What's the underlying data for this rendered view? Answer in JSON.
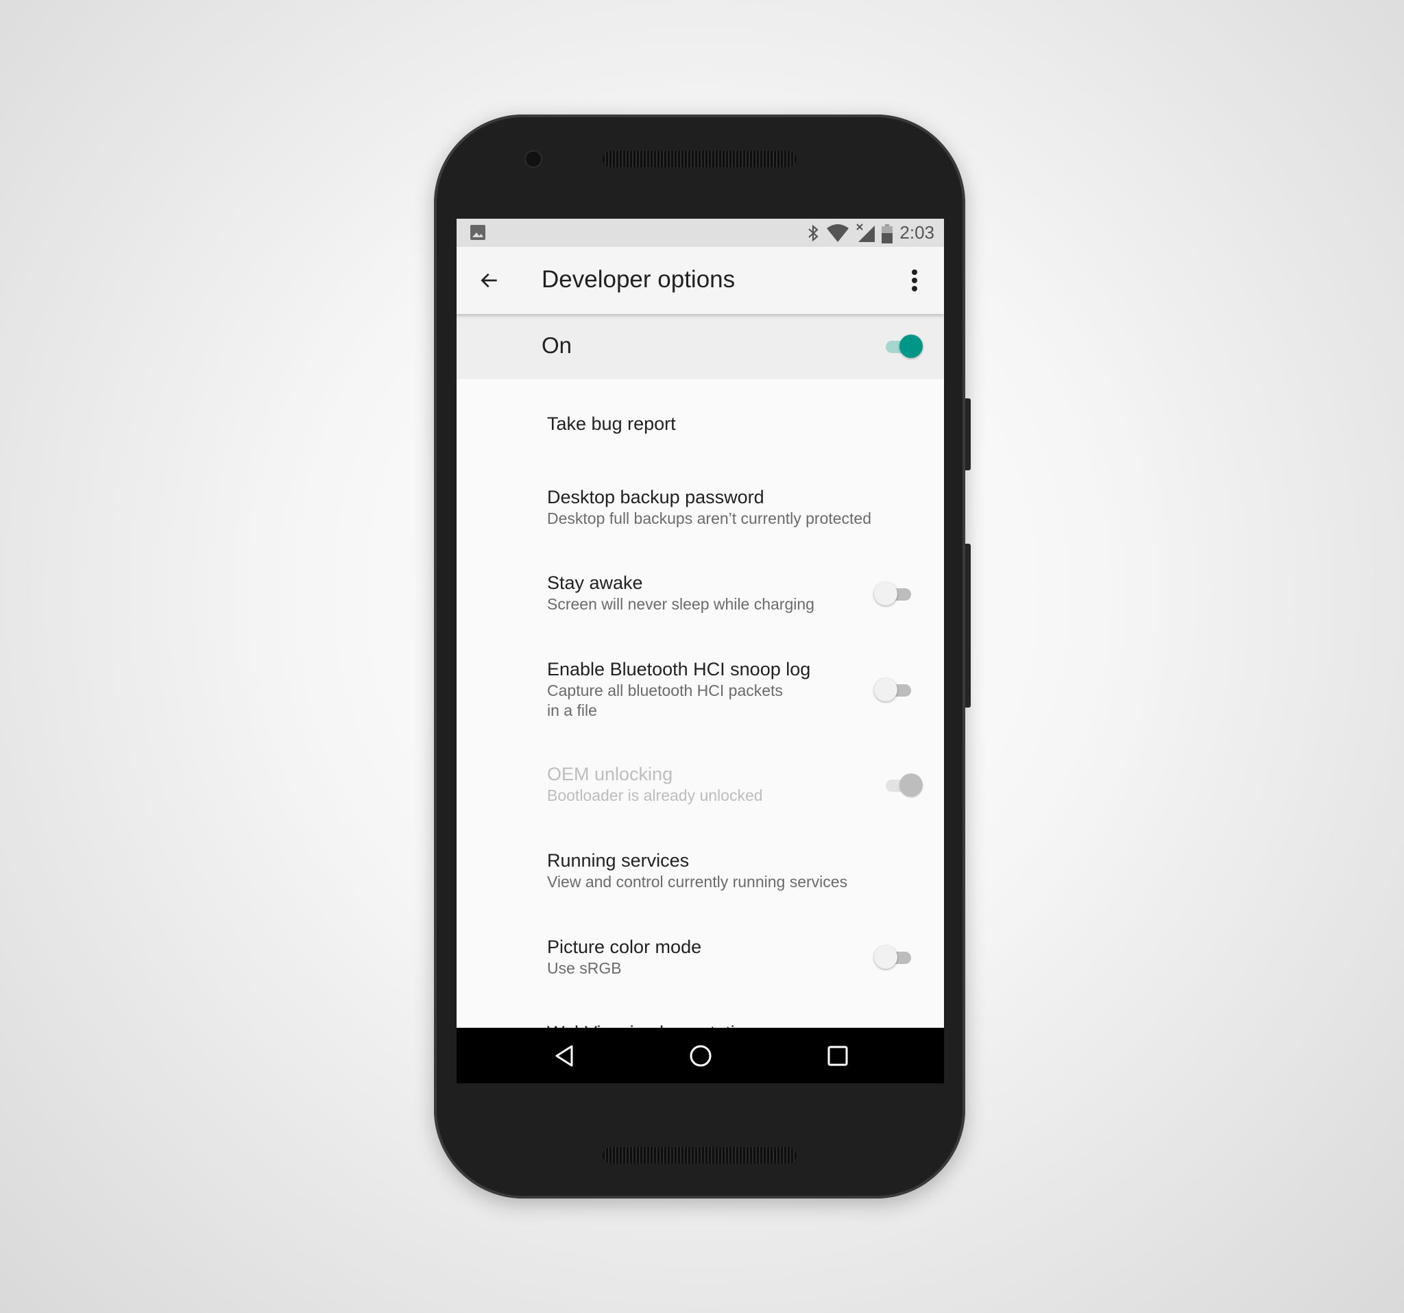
{
  "status_bar": {
    "time": "2:03",
    "icons": [
      "image-notification-icon",
      "bluetooth-icon",
      "wifi-icon",
      "signal-no-data-icon",
      "battery-icon"
    ]
  },
  "toolbar": {
    "title": "Developer options",
    "back_icon": "arrow-back-icon",
    "menu_icon": "more-vert-icon"
  },
  "master_switch": {
    "label": "On",
    "checked": true,
    "accent": "#009688"
  },
  "settings": [
    {
      "title": "Take bug report"
    },
    {
      "title": "Desktop backup password",
      "summary": "Desktop full backups aren’t currently protected"
    },
    {
      "title": "Stay awake",
      "summary": "Screen will never sleep while charging",
      "toggle": false
    },
    {
      "title": "Enable Bluetooth HCI snoop log",
      "summary": "Capture all bluetooth HCI packets",
      "summary2": "in a file",
      "toggle": false
    },
    {
      "title": "OEM unlocking",
      "summary": "Bootloader is already unlocked",
      "toggle": true,
      "disabled": true
    },
    {
      "title": "Running services",
      "summary": "View and control currently running services"
    },
    {
      "title": "Picture color mode",
      "summary": "Use sRGB",
      "toggle": false
    },
    {
      "title": "WebView implementation"
    }
  ],
  "nav_bar": {
    "back": "nav-back-icon",
    "home": "nav-home-icon",
    "recents": "nav-recents-icon"
  }
}
